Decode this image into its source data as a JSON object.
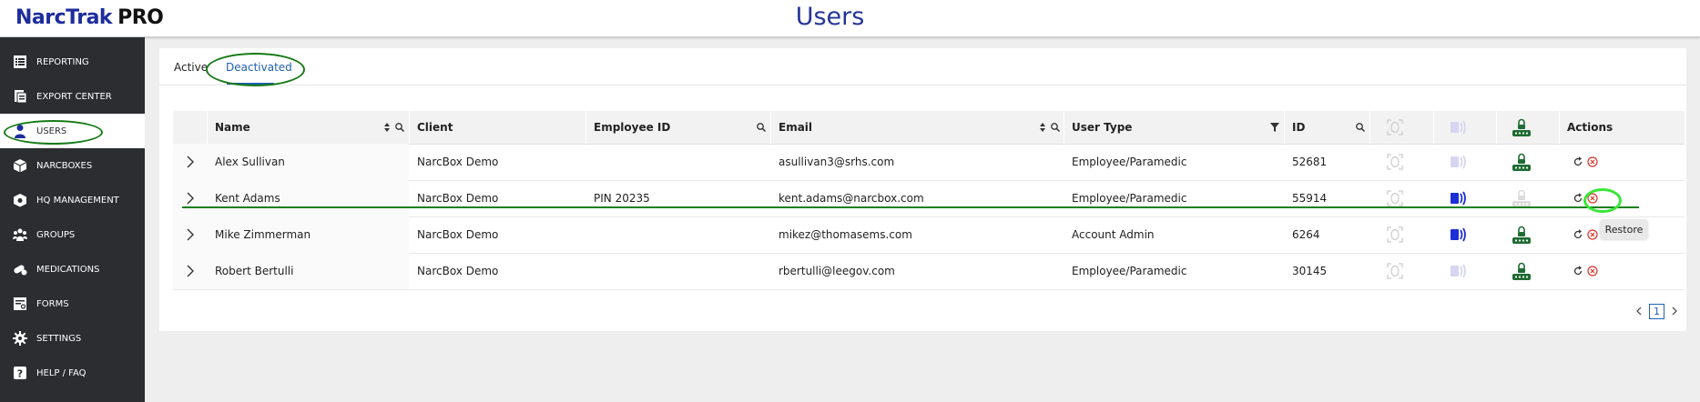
{
  "app": {
    "logo_main": "NarcTrak",
    "logo_suffix": "PRO"
  },
  "page": {
    "title": "Users"
  },
  "sidebar": {
    "items": [
      {
        "label": "REPORTING",
        "icon": "list-icon"
      },
      {
        "label": "EXPORT CENTER",
        "icon": "export-icon"
      },
      {
        "label": "USERS",
        "icon": "user-icon",
        "active": true
      },
      {
        "label": "NARCBOXES",
        "icon": "box-icon"
      },
      {
        "label": "HQ MANAGEMENT",
        "icon": "hq-icon"
      },
      {
        "label": "GROUPS",
        "icon": "groups-icon"
      },
      {
        "label": "MEDICATIONS",
        "icon": "pills-icon"
      },
      {
        "label": "FORMS",
        "icon": "forms-icon"
      },
      {
        "label": "SETTINGS",
        "icon": "gear-icon"
      },
      {
        "label": "HELP / FAQ",
        "icon": "help-icon"
      }
    ]
  },
  "tabs": [
    {
      "label": "Active",
      "selected": false
    },
    {
      "label": "Deactivated",
      "selected": true
    }
  ],
  "table": {
    "columns": {
      "name": "Name",
      "client": "Client",
      "employee_id": "Employee ID",
      "email": "Email",
      "user_type": "User Type",
      "id": "ID",
      "actions": "Actions"
    },
    "rows": [
      {
        "name": "Alex Sullivan",
        "client": "NarcBox Demo",
        "employee_id": "",
        "email": "asullivan3@srhs.com",
        "user_type": "Employee/Paramedic",
        "id": "52681",
        "fingerprint": false,
        "nfc": false,
        "pin": true
      },
      {
        "name": "Kent Adams",
        "client": "NarcBox Demo",
        "employee_id": "PIN 20235",
        "email": "kent.adams@narcbox.com",
        "user_type": "Employee/Paramedic",
        "id": "55914",
        "fingerprint": false,
        "nfc": true,
        "pin": false
      },
      {
        "name": "Mike Zimmerman",
        "client": "NarcBox Demo",
        "employee_id": "",
        "email": "mikez@thomasems.com",
        "user_type": "Account Admin",
        "id": "6264",
        "fingerprint": false,
        "nfc": true,
        "pin": true
      },
      {
        "name": "Robert Bertulli",
        "client": "NarcBox Demo",
        "employee_id": "",
        "email": "rbertulli@leegov.com",
        "user_type": "Employee/Paramedic",
        "id": "30145",
        "fingerprint": false,
        "nfc": false,
        "pin": true
      }
    ]
  },
  "tooltip": {
    "text": "Restore"
  },
  "pagination": {
    "current": "1"
  },
  "colors": {
    "brand": "#1d2d9c",
    "sidebar": "#2b2d31",
    "annotation_green": "#167a16",
    "highlight_green": "#39e639",
    "pin_green": "#1f6b33",
    "nfc_blue": "#1d2fd6",
    "delete_red": "#d9342b"
  }
}
